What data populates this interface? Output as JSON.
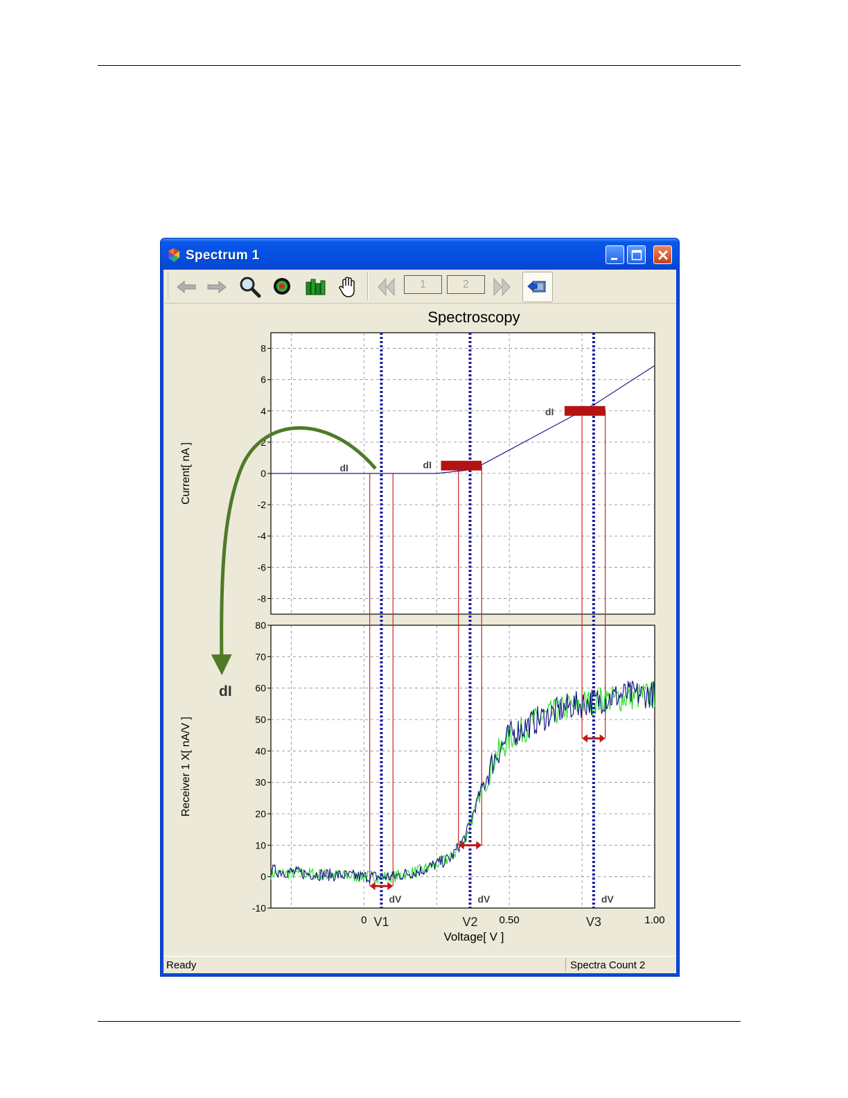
{
  "window": {
    "title": "Spectrum  1"
  },
  "toolbar": {
    "page_boxes": [
      "1",
      "2"
    ],
    "icons": [
      "arrow-left-icon",
      "arrow-right-icon",
      "zoom-icon",
      "target-icon",
      "bar-chart-icon",
      "hand-pan-icon",
      "rewind-icon",
      "fast-forward-icon",
      "export-icon"
    ]
  },
  "chart": {
    "title": "Spectroscopy",
    "top_ylabel": "Current[ nA ]",
    "bottom_ylabel": "Receiver 1 X[ nA/V ]",
    "xlabel": "Voltage[ V ]",
    "annotations": {
      "dI_labels": [
        "dI",
        "dI",
        "dI"
      ],
      "big_dI": "dI",
      "dV_labels": [
        "dV",
        "dV",
        "dV"
      ],
      "voltage_markers": [
        "V1",
        "V2",
        "V3"
      ]
    }
  },
  "chart_data": [
    {
      "type": "line",
      "title": "Spectroscopy",
      "ylabel": "Current[ nA ]",
      "xlabel": "Voltage[ V ]",
      "ylim": [
        -9,
        9
      ],
      "xlim": [
        -0.32,
        1.0
      ],
      "y_ticks": [
        "8",
        "6",
        "4",
        "2",
        "0",
        "-2",
        "-4",
        "-6",
        "-8"
      ],
      "y_tick_values": [
        8,
        6,
        4,
        2,
        0,
        -2,
        -4,
        -6,
        -8
      ],
      "grid": true,
      "series": [
        {
          "color": "#1a1a8c",
          "x": [
            -0.32,
            0.0,
            0.25,
            0.35,
            0.4,
            0.5,
            0.6,
            0.7,
            0.8,
            0.9,
            1.0
          ],
          "y": [
            0,
            0,
            0,
            0.2,
            0.5,
            1.5,
            2.5,
            3.5,
            4.5,
            5.7,
            6.9
          ]
        }
      ],
      "markers_x": {
        "V1": 0.06,
        "V2": 0.365,
        "V3": 0.79
      }
    },
    {
      "type": "line",
      "ylabel": "Receiver 1 X[ nA/V ]",
      "xlabel": "Voltage[ V ]",
      "ylim": [
        -10,
        80
      ],
      "xlim": [
        -0.32,
        1.0
      ],
      "y_ticks": [
        "80",
        "70",
        "60",
        "50",
        "40",
        "30",
        "20",
        "10",
        "0",
        "-10"
      ],
      "y_tick_values": [
        80,
        70,
        60,
        50,
        40,
        30,
        20,
        10,
        0,
        -10
      ],
      "x_ticks": [
        "0",
        "0.50",
        "1.00"
      ],
      "x_tick_values": [
        0,
        0.5,
        1.0
      ],
      "grid": true,
      "series": [
        {
          "color": "#22dd22",
          "x": [
            -0.32,
            -0.2,
            0.0,
            0.1,
            0.2,
            0.3,
            0.35,
            0.4,
            0.45,
            0.5,
            0.6,
            0.7,
            0.8,
            0.9,
            1.0
          ],
          "y": [
            1,
            1,
            0,
            0,
            2,
            6,
            12,
            26,
            38,
            44,
            50,
            54,
            56,
            57,
            58
          ]
        },
        {
          "color": "#101080",
          "x": [
            -0.32,
            -0.2,
            0.0,
            0.1,
            0.2,
            0.3,
            0.35,
            0.4,
            0.45,
            0.5,
            0.6,
            0.7,
            0.8,
            0.9,
            1.0
          ],
          "y": [
            2,
            1,
            0,
            0,
            2,
            6,
            13,
            27,
            38,
            45,
            50,
            54,
            56,
            58,
            58
          ]
        }
      ]
    }
  ],
  "status": {
    "left": "Ready",
    "right": "Spectra Count 2"
  }
}
